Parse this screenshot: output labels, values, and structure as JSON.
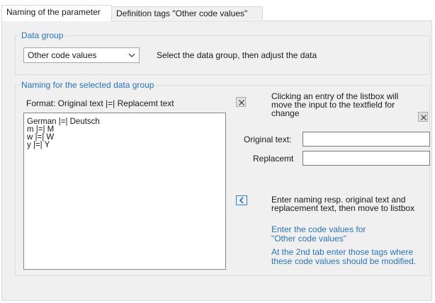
{
  "tabs": [
    {
      "label": "Naming of the parameter",
      "active": true
    },
    {
      "label": "Definition tags \"Other code values\"",
      "active": false
    }
  ],
  "data_group": {
    "legend": "Data group",
    "selected": "Other code values",
    "hint": "Select the data group, then adjust the data"
  },
  "naming_group": {
    "legend": "Naming for the selected data group",
    "format_label": "Format: Original text |=| Replacemt text",
    "list_items": [
      "German |=| Deutsch",
      "m |=| M",
      "w |=| W",
      "y |=| Y"
    ],
    "click_hint_line1": "Clicking an entry of the listbox will",
    "click_hint_line2": "move the input to the textfield  for",
    "click_hint_line3": "change",
    "original_label": "Original text:",
    "original_value": "",
    "replacement_label": "Replacemt",
    "replacement_value": "",
    "move_hint_line1": "Enter naming resp. original text and",
    "move_hint_line2": "replacement text, then move to listbox",
    "info1_line1": "Enter the code values for",
    "info1_line2": "\"Other code values\"",
    "info2_line1": "At the 2nd tab enter those tags where",
    "info2_line2": "these code values should be modified."
  },
  "colors": {
    "accent": "#2a73b8",
    "panel_bg": "#f0f0f0",
    "button_border": "#3c7fb1"
  }
}
